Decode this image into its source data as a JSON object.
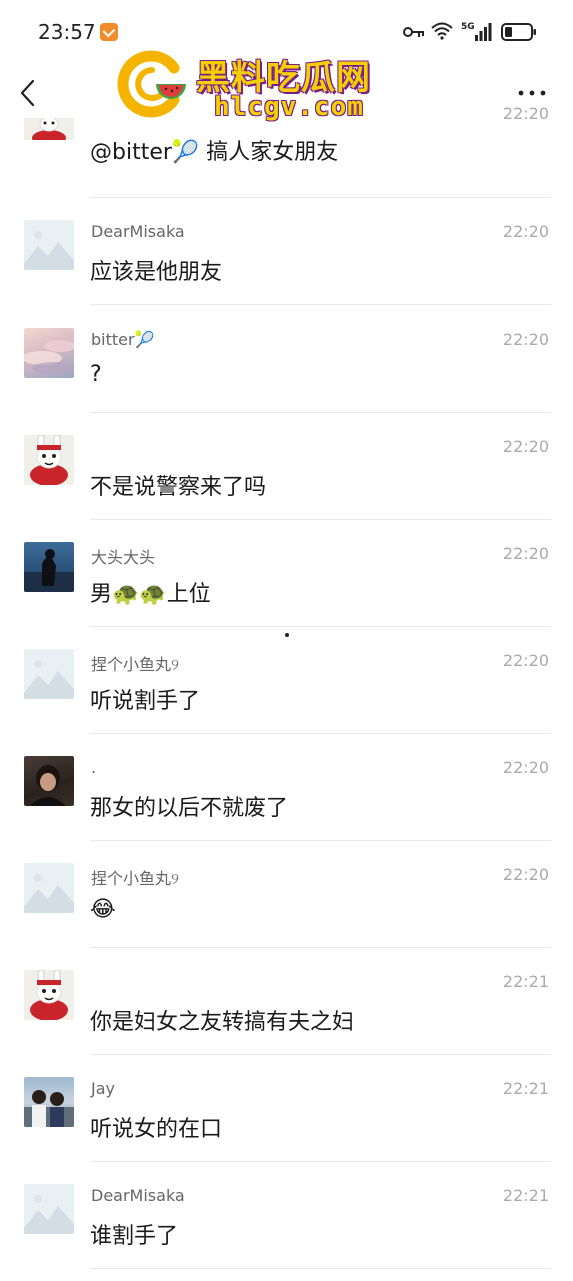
{
  "status_bar": {
    "time": "23:57",
    "network_label": "5G"
  },
  "watermark": {
    "title": "黑料吃瓜网",
    "url": "hlcgv.com"
  },
  "messages": [
    {
      "sender": "",
      "time": "22:20",
      "text": "@bitter🎾 搞人家女朋友",
      "avatar": "bunny"
    },
    {
      "sender": "DearMisaka",
      "time": "22:20",
      "text": "应该是他朋友",
      "avatar": "default"
    },
    {
      "sender": "bitter🎾",
      "time": "22:20",
      "text": "?",
      "avatar": "sky"
    },
    {
      "sender": "",
      "time": "22:20",
      "text": "不是说警察来了吗",
      "avatar": "bunny"
    },
    {
      "sender": "大头大头",
      "time": "22:20",
      "text": "男🐢🐢上位",
      "avatar": "sea"
    },
    {
      "sender": "捏个小鱼丸୨",
      "time": "22:20",
      "text": "听说割手了",
      "avatar": "default"
    },
    {
      "sender": ".",
      "time": "22:20",
      "text": "那女的以后不就废了",
      "avatar": "dark"
    },
    {
      "sender": "捏个小鱼丸୨",
      "time": "22:20",
      "text": "😂",
      "avatar": "default"
    },
    {
      "sender": "",
      "time": "22:21",
      "text": "你是妇女之友转搞有夫之妇",
      "avatar": "bunny"
    },
    {
      "sender": "Jay",
      "time": "22:21",
      "text": "听说女的在口",
      "avatar": "jay"
    },
    {
      "sender": "DearMisaka",
      "time": "22:21",
      "text": "谁割手了",
      "avatar": "default"
    }
  ]
}
